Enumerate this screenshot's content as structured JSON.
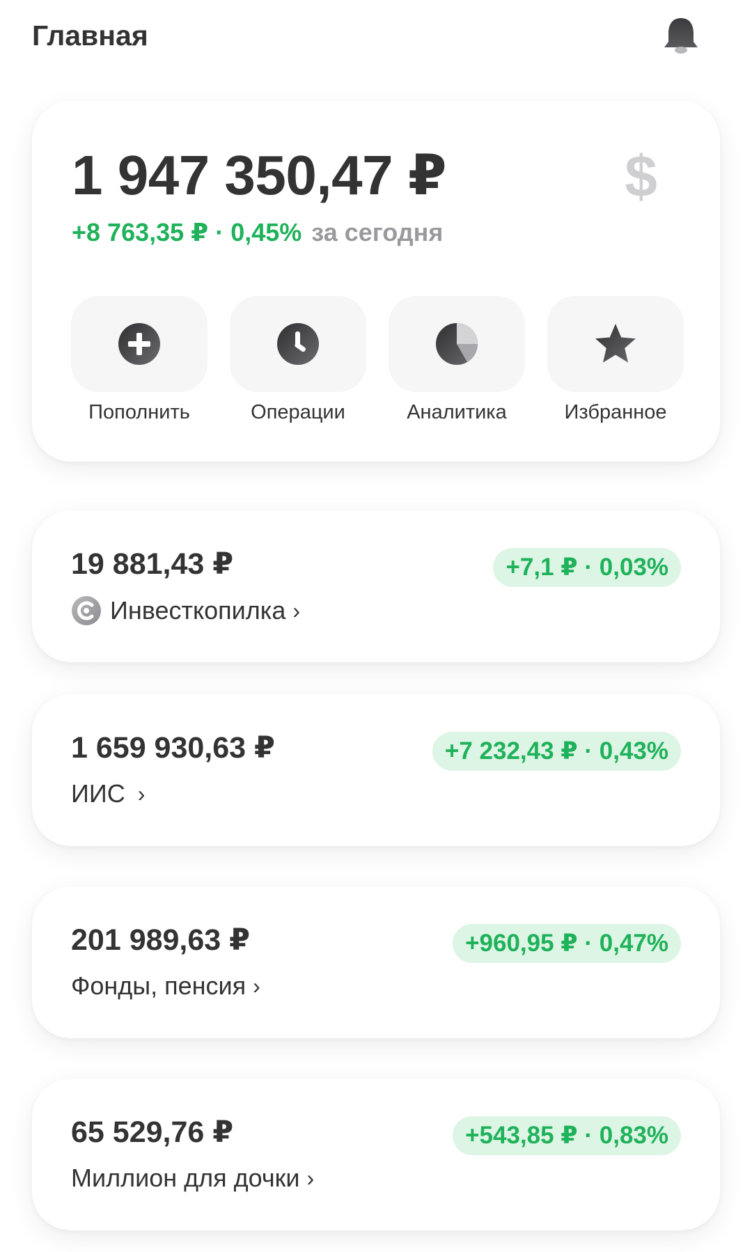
{
  "header": {
    "title": "Главная",
    "bell_icon": "bell-icon"
  },
  "summary": {
    "total": "1 947 350,47 ₽",
    "currency_symbol": "$",
    "change": "+8 763,35 ₽ · 0,45%",
    "period": "за сегодня",
    "actions": [
      {
        "label": "Пополнить",
        "icon": "plus-circle-icon"
      },
      {
        "label": "Операции",
        "icon": "clock-icon"
      },
      {
        "label": "Аналитика",
        "icon": "pie-chart-icon"
      },
      {
        "label": "Избранное",
        "icon": "star-icon"
      }
    ]
  },
  "accounts": [
    {
      "amount": "19 881,43 ₽",
      "name": "Инвесткопилка",
      "change": "+7,1 ₽ · 0,03%"
    },
    {
      "amount": "1 659 930,63 ₽",
      "name": "ИИС",
      "change": "+7 232,43 ₽ · 0,43%"
    },
    {
      "amount": "201 989,63 ₽",
      "name": "Фонды, пенсия",
      "change": "+960,95 ₽ · 0,47%"
    },
    {
      "amount": "65 529,76 ₽",
      "name": "Миллион для дочки",
      "change": "+543,85 ₽ · 0,83%"
    }
  ],
  "chevron": "›",
  "colors": {
    "positive": "#1fb25a",
    "positive_bg": "#ddf5e5",
    "text": "#333333",
    "muted": "#9a9a9e",
    "tile_bg": "#f6f6f7"
  }
}
